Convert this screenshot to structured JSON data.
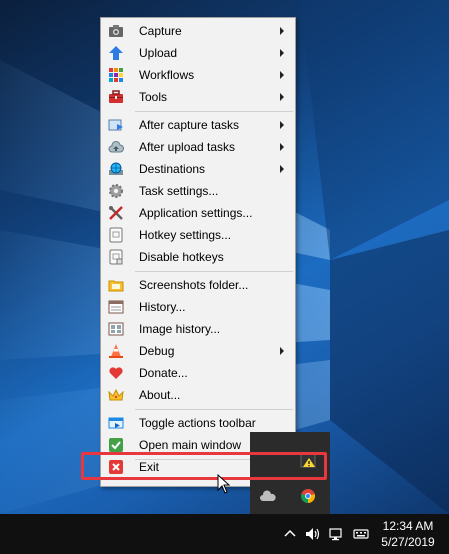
{
  "menu": {
    "items": [
      {
        "label": "Capture",
        "icon": "camera-icon",
        "submenu": true
      },
      {
        "label": "Upload",
        "icon": "upload-arrow-icon",
        "submenu": true
      },
      {
        "label": "Workflows",
        "icon": "grid-icon",
        "submenu": true
      },
      {
        "label": "Tools",
        "icon": "toolbox-icon",
        "submenu": true
      },
      {
        "label": "After capture tasks",
        "icon": "image-arrow-icon",
        "submenu": true
      },
      {
        "label": "After upload tasks",
        "icon": "cloud-icon",
        "submenu": true
      },
      {
        "label": "Destinations",
        "icon": "globe-monitor-icon",
        "submenu": true
      },
      {
        "label": "Task settings...",
        "icon": "gear-icon",
        "submenu": false
      },
      {
        "label": "Application settings...",
        "icon": "wrench-screwdriver-icon",
        "submenu": false
      },
      {
        "label": "Hotkey settings...",
        "icon": "keyboard-key-icon",
        "submenu": false
      },
      {
        "label": "Disable hotkeys",
        "icon": "keyboard-key-disabled-icon",
        "submenu": false
      },
      {
        "label": "Screenshots folder...",
        "icon": "folder-icon",
        "submenu": false
      },
      {
        "label": "History...",
        "icon": "history-window-icon",
        "submenu": false
      },
      {
        "label": "Image history...",
        "icon": "image-grid-icon",
        "submenu": false
      },
      {
        "label": "Debug",
        "icon": "traffic-cone-icon",
        "submenu": true
      },
      {
        "label": "Donate...",
        "icon": "heart-icon",
        "submenu": false
      },
      {
        "label": "About...",
        "icon": "crown-icon",
        "submenu": false
      },
      {
        "label": "Toggle actions toolbar",
        "icon": "toolbar-icon",
        "submenu": false
      },
      {
        "label": "Open main window",
        "icon": "check-icon",
        "submenu": false
      },
      {
        "label": "Exit",
        "icon": "close-x-icon",
        "submenu": false
      }
    ]
  },
  "taskbar": {
    "time": "12:34 AM",
    "date": "5/27/2019"
  },
  "colors": {
    "highlight_border": "#e8383f",
    "menu_background": "#f2f2f2",
    "taskbar_background": "#101010"
  }
}
